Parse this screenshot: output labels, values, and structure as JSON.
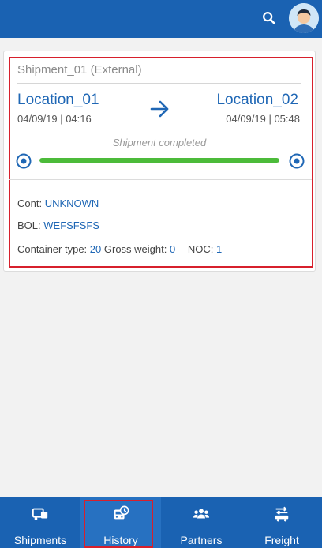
{
  "shipment": {
    "name": "Shipment_01 (External)",
    "origin": {
      "location": "Location_01",
      "datetime": "04/09/19 | 04:16"
    },
    "destination": {
      "location": "Location_02",
      "datetime": "04/09/19 | 05:48"
    },
    "status": "Shipment completed",
    "progress": 1.0,
    "cont_label": "Cont:",
    "cont_value": "UNKNOWN",
    "bol_label": "BOL:",
    "bol_value": "WEFSFSFS",
    "container_type_label": "Container type:",
    "container_type_value": "20",
    "gross_weight_label": "Gross weight:",
    "gross_weight_value": "0",
    "noc_label": "NOC:",
    "noc_value": "1"
  },
  "nav": {
    "tabs": [
      {
        "label": "Shipments",
        "icon": "shipments-icon"
      },
      {
        "label": "History",
        "icon": "history-icon",
        "active": true
      },
      {
        "label": "Partners",
        "icon": "partners-icon"
      },
      {
        "label": "Freight",
        "icon": "freight-icon"
      }
    ]
  },
  "colors": {
    "primary": "#1a62b2",
    "link": "#1f67b5",
    "progress": "#4cbb3a",
    "highlight": "#d7202c"
  }
}
